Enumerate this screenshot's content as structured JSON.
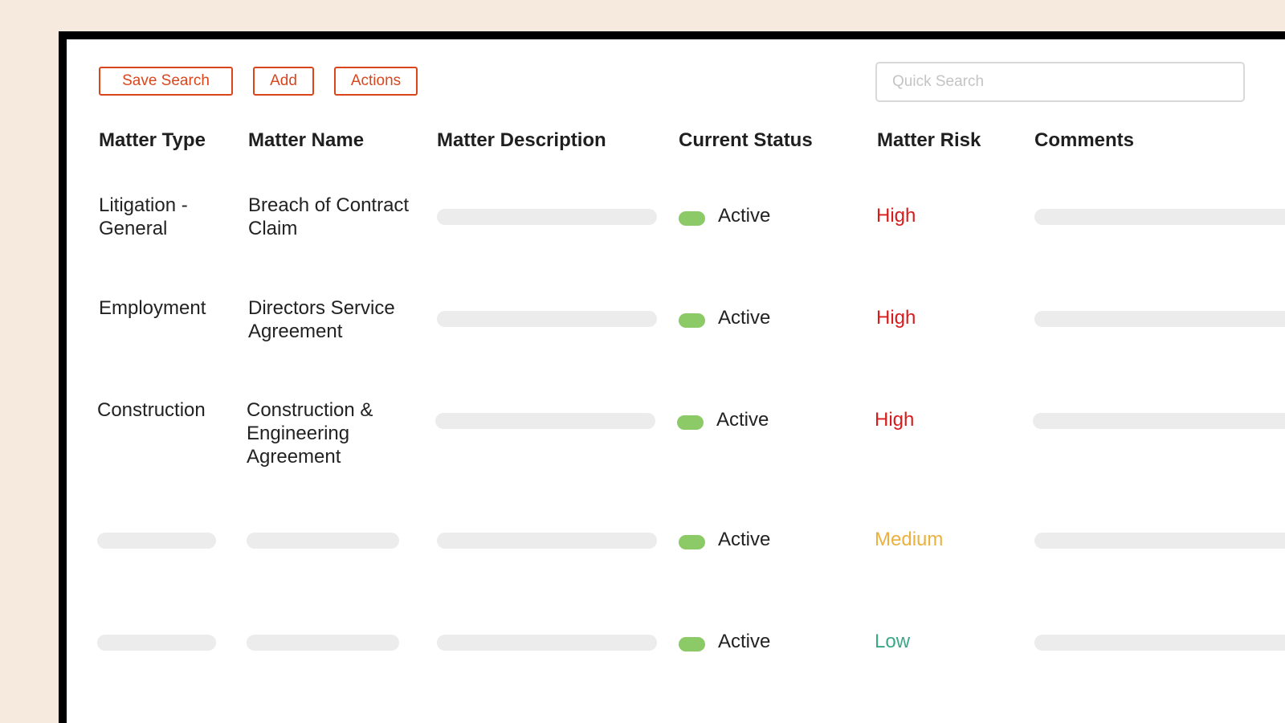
{
  "toolbar": {
    "save_search_label": "Save Search",
    "add_label": "Add",
    "actions_label": "Actions",
    "search_placeholder": "Quick Search",
    "search_value": ""
  },
  "table": {
    "columns": [
      "Matter Type",
      "Matter Name",
      "Matter Description",
      "Current Status",
      "Matter Risk",
      "Comments"
    ],
    "rows": [
      {
        "matter_type": "Litigation - General",
        "matter_name": "Breach of Contract Claim",
        "status": "Active",
        "risk": "High",
        "risk_color": "#d81b1b"
      },
      {
        "matter_type": "Employment",
        "matter_name": "Directors Service Agreement",
        "status": "Active",
        "risk": "High",
        "risk_color": "#d81b1b"
      },
      {
        "matter_type": "Construction",
        "matter_name": "Construction & Engineering Agreement",
        "status": "Active",
        "risk": "High",
        "risk_color": "#d81b1b"
      },
      {
        "matter_type": null,
        "matter_name": null,
        "status": "Active",
        "risk": "Medium",
        "risk_color": "#ecb03e"
      },
      {
        "matter_type": null,
        "matter_name": null,
        "status": "Active",
        "risk": "Low",
        "risk_color": "#3aa887"
      }
    ]
  },
  "colors": {
    "accent": "#d9461c",
    "status_active": "#8cc967",
    "placeholder_bar": "#ececec",
    "background": "#f6e9dd"
  }
}
